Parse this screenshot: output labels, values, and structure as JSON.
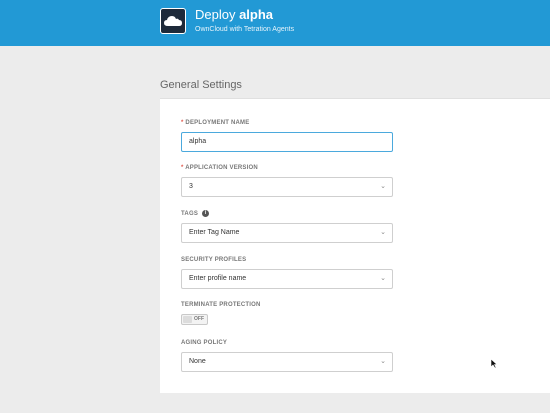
{
  "header": {
    "title_prefix": "Deploy ",
    "title_name": "alpha",
    "subtitle": "OwnCloud with Tetration Agents",
    "logo_icon": "cloud-icon",
    "bg_color": "#2299d5"
  },
  "section": {
    "title": "General Settings"
  },
  "fields": {
    "deployment_name": {
      "required_mark": "*",
      "label": "DEPLOYMENT NAME",
      "value": "alpha"
    },
    "app_version": {
      "required_mark": "*",
      "label": "APPLICATION VERSION",
      "value": "3"
    },
    "tags": {
      "label": "TAGS",
      "placeholder": "Enter Tag Name",
      "info_icon": "i"
    },
    "security_profiles": {
      "label": "SECURITY PROFILES",
      "placeholder": "Enter profile name"
    },
    "terminate_protection": {
      "label": "TERMINATE PROTECTION",
      "state": "OFF"
    },
    "aging_policy": {
      "label": "AGING POLICY",
      "value": "None"
    }
  },
  "chevron_glyph": "⌄"
}
